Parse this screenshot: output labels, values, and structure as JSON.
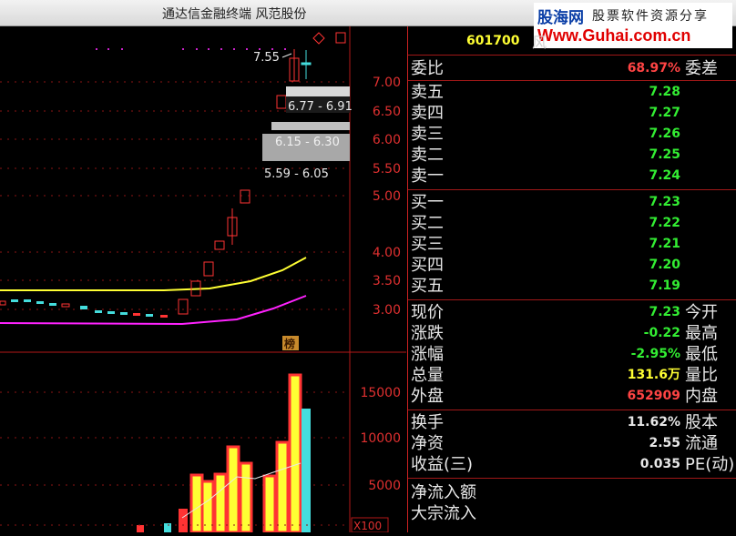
{
  "window": {
    "title": "通达信金融终端 风范股份"
  },
  "watermark": {
    "brand": "股海网",
    "slogan": "股票软件资源分享",
    "url": "Www.Guhai.com.cn"
  },
  "chart": {
    "price_axis": [
      "7.00",
      "6.50",
      "6.00",
      "5.50",
      "5.00",
      "4.00",
      "3.50",
      "3.00"
    ],
    "volume_axis": [
      "15000",
      "10000",
      "5000"
    ],
    "volume_unit": "X100",
    "high_label": "7.55",
    "bands": [
      "6.77 - 6.91",
      "6.15 - 6.30",
      "5.59 - 6.05"
    ],
    "badge": "榜"
  },
  "quote": {
    "code": "601700",
    "name": "风",
    "weibi": {
      "label": "委比",
      "value": "68.97%",
      "label2": "委差"
    },
    "sell": [
      {
        "label": "卖五",
        "price": "7.28"
      },
      {
        "label": "卖四",
        "price": "7.27"
      },
      {
        "label": "卖三",
        "price": "7.26"
      },
      {
        "label": "卖二",
        "price": "7.25"
      },
      {
        "label": "卖一",
        "price": "7.24"
      }
    ],
    "buy": [
      {
        "label": "买一",
        "price": "7.23"
      },
      {
        "label": "买二",
        "price": "7.22"
      },
      {
        "label": "买三",
        "price": "7.21"
      },
      {
        "label": "买四",
        "price": "7.20"
      },
      {
        "label": "买五",
        "price": "7.19"
      }
    ],
    "stats1": [
      {
        "label": "现价",
        "value": "7.23",
        "label2": "今开"
      },
      {
        "label": "涨跌",
        "value": "-0.22",
        "label2": "最高"
      },
      {
        "label": "涨幅",
        "value": "-2.95%",
        "label2": "最低"
      },
      {
        "label": "总量",
        "value": "131.6万",
        "label2": "量比"
      },
      {
        "label": "外盘",
        "value": "652909",
        "label2": "内盘"
      }
    ],
    "stats2": [
      {
        "label": "换手",
        "value": "11.62%",
        "label2": "股本"
      },
      {
        "label": "净资",
        "value": "2.55",
        "label2": "流通"
      },
      {
        "label": "收益(三)",
        "value": "0.035",
        "label2": "PE(动)"
      }
    ],
    "extra": [
      {
        "label": "净流入额"
      },
      {
        "label": "大宗流入"
      }
    ]
  },
  "colors": {
    "up": "#ff3333",
    "down": "#44dddd",
    "ma_yellow": "#ffff33",
    "ma_magenta": "#ff22ff",
    "grid": "#a01818"
  }
}
